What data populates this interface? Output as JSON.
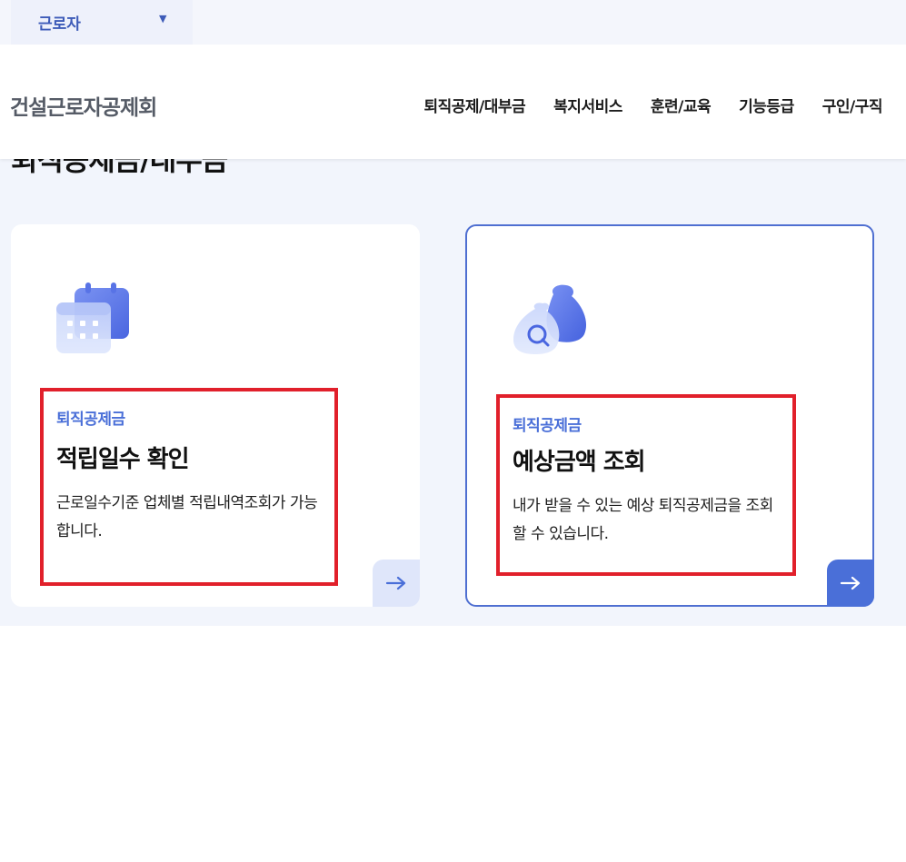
{
  "top_bar": {
    "user_type": "근로자"
  },
  "header": {
    "logo": "건설근로자공제회",
    "nav": [
      "퇴직공제/대부금",
      "복지서비스",
      "훈련/교육",
      "기능등급",
      "구인/구직"
    ]
  },
  "page": {
    "title": "퇴직공제금/대부금"
  },
  "cards": [
    {
      "category": "퇴직공제금",
      "title": "적립일수 확인",
      "description": "근로일수기준 업체별 적립내역조회가 가능합니다.",
      "icon": "calendar-icon",
      "action_icon": "arrow-right-icon"
    },
    {
      "category": "퇴직공제금",
      "title": "예상금액 조회",
      "description": "내가 받을 수 있는 예상 퇴직공제금을 조회할 수 있습니다.",
      "icon": "money-bag-search-icon",
      "action_icon": "arrow-right-icon"
    }
  ],
  "colors": {
    "accent": "#4a6fd8",
    "highlight_border": "#e1202b",
    "background": "#f2f5fc"
  }
}
